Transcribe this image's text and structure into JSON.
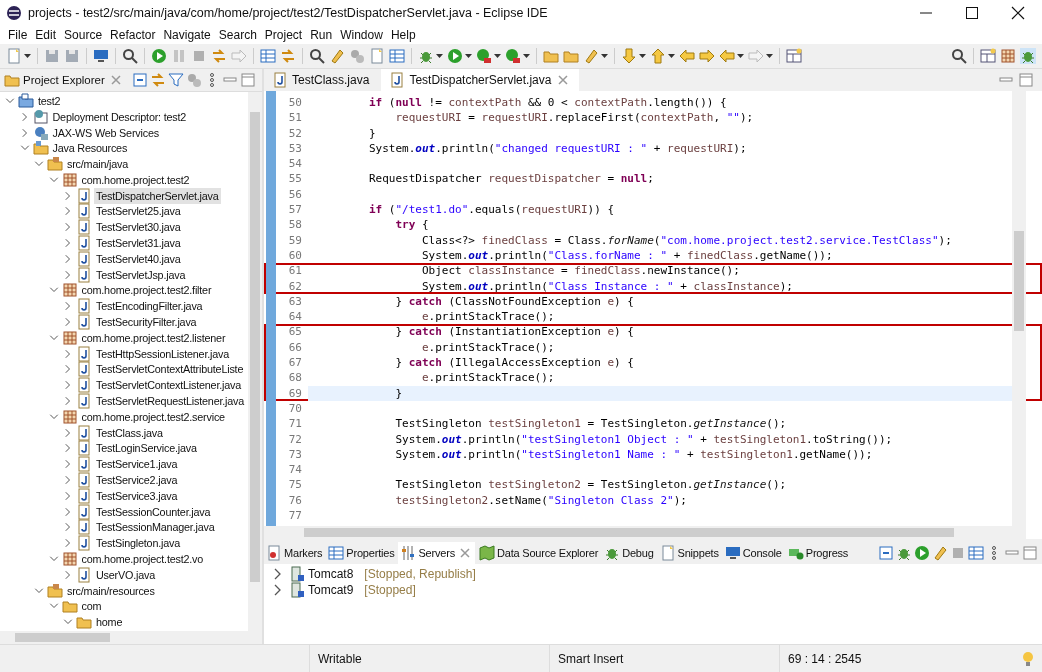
{
  "window": {
    "title": "projects - test2/src/main/java/com/home/project/test2/TestDispatcherServlet.java - Eclipse IDE"
  },
  "menu": [
    "File",
    "Edit",
    "Source",
    "Refactor",
    "Navigate",
    "Search",
    "Project",
    "Run",
    "Window",
    "Help"
  ],
  "project_explorer": {
    "title": "Project Explorer",
    "tree": [
      {
        "label": "test2",
        "kind": "project",
        "expanded": true,
        "selected": false,
        "children": [
          {
            "label": "Deployment Descriptor: test2",
            "kind": "descriptor",
            "expanded": false,
            "selected": false
          },
          {
            "label": "JAX-WS Web Services",
            "kind": "webservice",
            "expanded": false,
            "selected": false
          },
          {
            "label": "Java Resources",
            "kind": "resources",
            "expanded": true,
            "selected": false,
            "children": [
              {
                "label": "src/main/java",
                "kind": "srcfolder",
                "expanded": true,
                "selected": false,
                "children": [
                  {
                    "label": "com.home.project.test2",
                    "kind": "package",
                    "expanded": true,
                    "selected": false,
                    "children": [
                      {
                        "label": "TestDispatcherServlet.java",
                        "kind": "java",
                        "expanded": false,
                        "selected": true
                      },
                      {
                        "label": "TestServlet25.java",
                        "kind": "java",
                        "expanded": false,
                        "selected": false
                      },
                      {
                        "label": "TestServlet30.java",
                        "kind": "java",
                        "expanded": false,
                        "selected": false
                      },
                      {
                        "label": "TestServlet31.java",
                        "kind": "java",
                        "expanded": false,
                        "selected": false
                      },
                      {
                        "label": "TestServlet40.java",
                        "kind": "java",
                        "expanded": false,
                        "selected": false
                      },
                      {
                        "label": "TestServletJsp.java",
                        "kind": "java",
                        "expanded": false,
                        "selected": false
                      }
                    ]
                  },
                  {
                    "label": "com.home.project.test2.filter",
                    "kind": "package",
                    "expanded": true,
                    "selected": false,
                    "children": [
                      {
                        "label": "TestEncodingFilter.java",
                        "kind": "java",
                        "expanded": false,
                        "selected": false
                      },
                      {
                        "label": "TestSecurityFilter.java",
                        "kind": "java",
                        "expanded": false,
                        "selected": false
                      }
                    ]
                  },
                  {
                    "label": "com.home.project.test2.listener",
                    "kind": "package",
                    "expanded": true,
                    "selected": false,
                    "children": [
                      {
                        "label": "TestHttpSessionListener.java",
                        "kind": "java",
                        "expanded": false,
                        "selected": false
                      },
                      {
                        "label": "TestServletContextAttributeListe",
                        "kind": "java",
                        "expanded": false,
                        "selected": false
                      },
                      {
                        "label": "TestServletContextListener.java",
                        "kind": "java",
                        "expanded": false,
                        "selected": false
                      },
                      {
                        "label": "TestServletRequestListener.java",
                        "kind": "java",
                        "expanded": false,
                        "selected": false
                      }
                    ]
                  },
                  {
                    "label": "com.home.project.test2.service",
                    "kind": "package",
                    "expanded": true,
                    "selected": false,
                    "children": [
                      {
                        "label": "TestClass.java",
                        "kind": "java",
                        "expanded": false,
                        "selected": false
                      },
                      {
                        "label": "TestLoginService.java",
                        "kind": "java",
                        "expanded": false,
                        "selected": false
                      },
                      {
                        "label": "TestService1.java",
                        "kind": "java",
                        "expanded": false,
                        "selected": false
                      },
                      {
                        "label": "TestService2.java",
                        "kind": "java",
                        "expanded": false,
                        "selected": false
                      },
                      {
                        "label": "TestService3.java",
                        "kind": "java",
                        "expanded": false,
                        "selected": false
                      },
                      {
                        "label": "TestSessionCounter.java",
                        "kind": "java",
                        "expanded": false,
                        "selected": false
                      },
                      {
                        "label": "TestSessionManager.java",
                        "kind": "java",
                        "expanded": false,
                        "selected": false
                      },
                      {
                        "label": "TestSingleton.java",
                        "kind": "java",
                        "expanded": false,
                        "selected": false
                      }
                    ]
                  },
                  {
                    "label": "com.home.project.test2.vo",
                    "kind": "package",
                    "expanded": true,
                    "selected": false,
                    "children": [
                      {
                        "label": "UserVO.java",
                        "kind": "java",
                        "expanded": false,
                        "selected": false
                      }
                    ]
                  }
                ]
              },
              {
                "label": "src/main/resources",
                "kind": "srcfolder",
                "expanded": true,
                "selected": false,
                "children": [
                  {
                    "label": "com",
                    "kind": "folder",
                    "expanded": true,
                    "selected": false,
                    "children": [
                      {
                        "label": "home",
                        "kind": "folder",
                        "expanded": true,
                        "selected": false
                      }
                    ]
                  }
                ]
              }
            ]
          }
        ]
      }
    ]
  },
  "editor": {
    "tabs": [
      {
        "label": "TestClass.java",
        "selected": false
      },
      {
        "label": "TestDispatcherServlet.java",
        "selected": true
      }
    ],
    "lines": [
      {
        "number": "50",
        "current": false,
        "highlighted": false,
        "tokens": [
          {
            "kind": "keyword",
            "text": "        if"
          },
          {
            "kind": "plain",
            "text": " ("
          },
          {
            "kind": "keyword",
            "text": "null"
          },
          {
            "kind": "plain",
            "text": " != "
          },
          {
            "kind": "variable",
            "text": "contextPath"
          },
          {
            "kind": "plain",
            "text": " && 0 < "
          },
          {
            "kind": "variable",
            "text": "contextPath"
          },
          {
            "kind": "plain",
            "text": ".length()) {"
          }
        ]
      },
      {
        "number": "51",
        "current": false,
        "highlighted": false,
        "tokens": [
          {
            "kind": "variable",
            "text": "            requestURI"
          },
          {
            "kind": "plain",
            "text": " = "
          },
          {
            "kind": "variable",
            "text": "requestURI"
          },
          {
            "kind": "plain",
            "text": ".replaceFirst("
          },
          {
            "kind": "variable",
            "text": "contextPath"
          },
          {
            "kind": "plain",
            "text": ", "
          },
          {
            "kind": "string",
            "text": "\"\""
          },
          {
            "kind": "plain",
            "text": ");"
          }
        ]
      },
      {
        "number": "52",
        "current": false,
        "highlighted": false,
        "tokens": [
          {
            "kind": "plain",
            "text": "        }"
          }
        ]
      },
      {
        "number": "53",
        "current": false,
        "highlighted": false,
        "tokens": [
          {
            "kind": "plain",
            "text": "        System."
          },
          {
            "kind": "field",
            "text": "out"
          },
          {
            "kind": "plain",
            "text": ".println("
          },
          {
            "kind": "string",
            "text": "\"changed requestURI : \""
          },
          {
            "kind": "plain",
            "text": " + "
          },
          {
            "kind": "variable",
            "text": "requestURI"
          },
          {
            "kind": "plain",
            "text": ");"
          }
        ]
      },
      {
        "number": "54",
        "current": false,
        "highlighted": false
      },
      {
        "number": "55",
        "current": false,
        "highlighted": false,
        "tokens": [
          {
            "kind": "plain",
            "text": "        RequestDispatcher "
          },
          {
            "kind": "variable",
            "text": "requestDispatcher"
          },
          {
            "kind": "plain",
            "text": " = "
          },
          {
            "kind": "keyword",
            "text": "null"
          },
          {
            "kind": "plain",
            "text": ";"
          }
        ]
      },
      {
        "number": "56",
        "current": false,
        "highlighted": false
      },
      {
        "number": "57",
        "current": false,
        "highlighted": false,
        "tokens": [
          {
            "kind": "keyword",
            "text": "        if"
          },
          {
            "kind": "plain",
            "text": " ("
          },
          {
            "kind": "string",
            "text": "\"/test1.do\""
          },
          {
            "kind": "plain",
            "text": ".equals("
          },
          {
            "kind": "variable",
            "text": "requestURI"
          },
          {
            "kind": "plain",
            "text": ")) {"
          }
        ]
      },
      {
        "number": "58",
        "current": false,
        "highlighted": false,
        "tokens": [
          {
            "kind": "keyword",
            "text": "            try"
          },
          {
            "kind": "plain",
            "text": " {"
          }
        ]
      },
      {
        "number": "59",
        "current": false,
        "highlighted": false,
        "tokens": [
          {
            "kind": "plain",
            "text": "                Class<?> "
          },
          {
            "kind": "variable",
            "text": "finedClass"
          },
          {
            "kind": "plain",
            "text": " = Class."
          },
          {
            "kind": "static",
            "text": "forName"
          },
          {
            "kind": "plain",
            "text": "("
          },
          {
            "kind": "string",
            "text": "\"com.home.project.test2.service.TestClass\""
          },
          {
            "kind": "plain",
            "text": ");"
          }
        ]
      },
      {
        "number": "60",
        "current": false,
        "highlighted": false,
        "tokens": [
          {
            "kind": "plain",
            "text": "                System."
          },
          {
            "kind": "field",
            "text": "out"
          },
          {
            "kind": "plain",
            "text": ".println("
          },
          {
            "kind": "string",
            "text": "\"Class.forName : \""
          },
          {
            "kind": "plain",
            "text": " + "
          },
          {
            "kind": "variable",
            "text": "finedClass"
          },
          {
            "kind": "plain",
            "text": ".getName());"
          }
        ]
      },
      {
        "number": "61",
        "current": false,
        "highlighted": true,
        "tokens": [
          {
            "kind": "plain",
            "text": "                Object "
          },
          {
            "kind": "variable",
            "text": "classInstance"
          },
          {
            "kind": "plain",
            "text": " = "
          },
          {
            "kind": "variable",
            "text": "finedClass"
          },
          {
            "kind": "plain",
            "text": ".newInstance();"
          }
        ]
      },
      {
        "number": "62",
        "current": false,
        "highlighted": true,
        "tokens": [
          {
            "kind": "plain",
            "text": "                System."
          },
          {
            "kind": "field",
            "text": "out"
          },
          {
            "kind": "plain",
            "text": ".println("
          },
          {
            "kind": "string",
            "text": "\"Class Instance : \""
          },
          {
            "kind": "plain",
            "text": " + "
          },
          {
            "kind": "variable",
            "text": "classInstance"
          },
          {
            "kind": "plain",
            "text": ");"
          }
        ]
      },
      {
        "number": "63",
        "current": false,
        "highlighted": false,
        "tokens": [
          {
            "kind": "plain",
            "text": "            } "
          },
          {
            "kind": "keyword",
            "text": "catch"
          },
          {
            "kind": "plain",
            "text": " (ClassNotFoundException "
          },
          {
            "kind": "variable",
            "text": "e"
          },
          {
            "kind": "plain",
            "text": ") {"
          }
        ]
      },
      {
        "number": "64",
        "current": false,
        "highlighted": false,
        "tokens": [
          {
            "kind": "variable",
            "text": "                e"
          },
          {
            "kind": "plain",
            "text": ".printStackTrace();"
          }
        ]
      },
      {
        "number": "65",
        "current": false,
        "highlighted": true,
        "tokens": [
          {
            "kind": "plain",
            "text": "            } "
          },
          {
            "kind": "keyword",
            "text": "catch"
          },
          {
            "kind": "plain",
            "text": " (InstantiationException "
          },
          {
            "kind": "variable",
            "text": "e"
          },
          {
            "kind": "plain",
            "text": ") {"
          }
        ]
      },
      {
        "number": "66",
        "current": false,
        "highlighted": true,
        "tokens": [
          {
            "kind": "variable",
            "text": "                e"
          },
          {
            "kind": "plain",
            "text": ".printStackTrace();"
          }
        ]
      },
      {
        "number": "67",
        "current": false,
        "highlighted": true,
        "tokens": [
          {
            "kind": "plain",
            "text": "            } "
          },
          {
            "kind": "keyword",
            "text": "catch"
          },
          {
            "kind": "plain",
            "text": " (IllegalAccessException "
          },
          {
            "kind": "variable",
            "text": "e"
          },
          {
            "kind": "plain",
            "text": ") {"
          }
        ]
      },
      {
        "number": "68",
        "current": false,
        "highlighted": true,
        "tokens": [
          {
            "kind": "variable",
            "text": "                e"
          },
          {
            "kind": "plain",
            "text": ".printStackTrace();"
          }
        ]
      },
      {
        "number": "69",
        "current": true,
        "highlighted": true,
        "tokens": [
          {
            "kind": "plain",
            "text": "            }"
          }
        ]
      },
      {
        "number": "70",
        "current": false,
        "highlighted": false
      },
      {
        "number": "71",
        "current": false,
        "highlighted": false,
        "tokens": [
          {
            "kind": "plain",
            "text": "            TestSingleton "
          },
          {
            "kind": "variable",
            "text": "testSingleton1"
          },
          {
            "kind": "plain",
            "text": " = TestSingleton."
          },
          {
            "kind": "static",
            "text": "getInstance"
          },
          {
            "kind": "plain",
            "text": "();"
          }
        ]
      },
      {
        "number": "72",
        "current": false,
        "highlighted": false,
        "tokens": [
          {
            "kind": "plain",
            "text": "            System."
          },
          {
            "kind": "field",
            "text": "out"
          },
          {
            "kind": "plain",
            "text": ".println("
          },
          {
            "kind": "string",
            "text": "\"testSingleton1 Object : \""
          },
          {
            "kind": "plain",
            "text": " + "
          },
          {
            "kind": "variable",
            "text": "testSingleton1"
          },
          {
            "kind": "plain",
            "text": ".toString());"
          }
        ]
      },
      {
        "number": "73",
        "current": false,
        "highlighted": false,
        "tokens": [
          {
            "kind": "plain",
            "text": "            System."
          },
          {
            "kind": "field",
            "text": "out"
          },
          {
            "kind": "plain",
            "text": ".println("
          },
          {
            "kind": "string",
            "text": "\"testSingleton1 Name : \""
          },
          {
            "kind": "plain",
            "text": " + "
          },
          {
            "kind": "variable",
            "text": "testSingleton1"
          },
          {
            "kind": "plain",
            "text": ".getName());"
          }
        ]
      },
      {
        "number": "74",
        "current": false,
        "highlighted": false
      },
      {
        "number": "75",
        "current": false,
        "highlighted": false,
        "tokens": [
          {
            "kind": "plain",
            "text": "            TestSingleton "
          },
          {
            "kind": "variable",
            "text": "testSingleton2"
          },
          {
            "kind": "plain",
            "text": " = TestSingleton."
          },
          {
            "kind": "static",
            "text": "getInstance"
          },
          {
            "kind": "plain",
            "text": "();"
          }
        ]
      },
      {
        "number": "76",
        "current": false,
        "highlighted": false,
        "tokens": [
          {
            "kind": "variable",
            "text": "            testSingleton2"
          },
          {
            "kind": "plain",
            "text": ".setName("
          },
          {
            "kind": "string",
            "text": "\"Singleton Class 2\""
          },
          {
            "kind": "plain",
            "text": ");"
          }
        ]
      },
      {
        "number": "77",
        "current": false,
        "highlighted": false
      }
    ]
  },
  "bottom_panel": {
    "tabs": [
      {
        "label": "Markers",
        "kind": "markers",
        "selected": false
      },
      {
        "label": "Properties",
        "kind": "properties",
        "selected": false
      },
      {
        "label": "Servers",
        "kind": "servers",
        "selected": true
      },
      {
        "label": "Data Source Explorer",
        "kind": "datasource",
        "selected": false
      },
      {
        "label": "Debug",
        "kind": "debug",
        "selected": false
      },
      {
        "label": "Snippets",
        "kind": "snippets",
        "selected": false
      },
      {
        "label": "Console",
        "kind": "console",
        "selected": false
      },
      {
        "label": "Progress",
        "kind": "progress",
        "selected": false
      }
    ],
    "servers": [
      {
        "name": "Tomcat8",
        "status": "[Stopped, Republish]",
        "expanded": false
      },
      {
        "name": "Tomcat9",
        "status": "[Stopped]",
        "expanded": false
      }
    ]
  },
  "status_bar": {
    "mode": "Writable",
    "insert": "Smart Insert",
    "position": "69 : 14 : 2545"
  }
}
